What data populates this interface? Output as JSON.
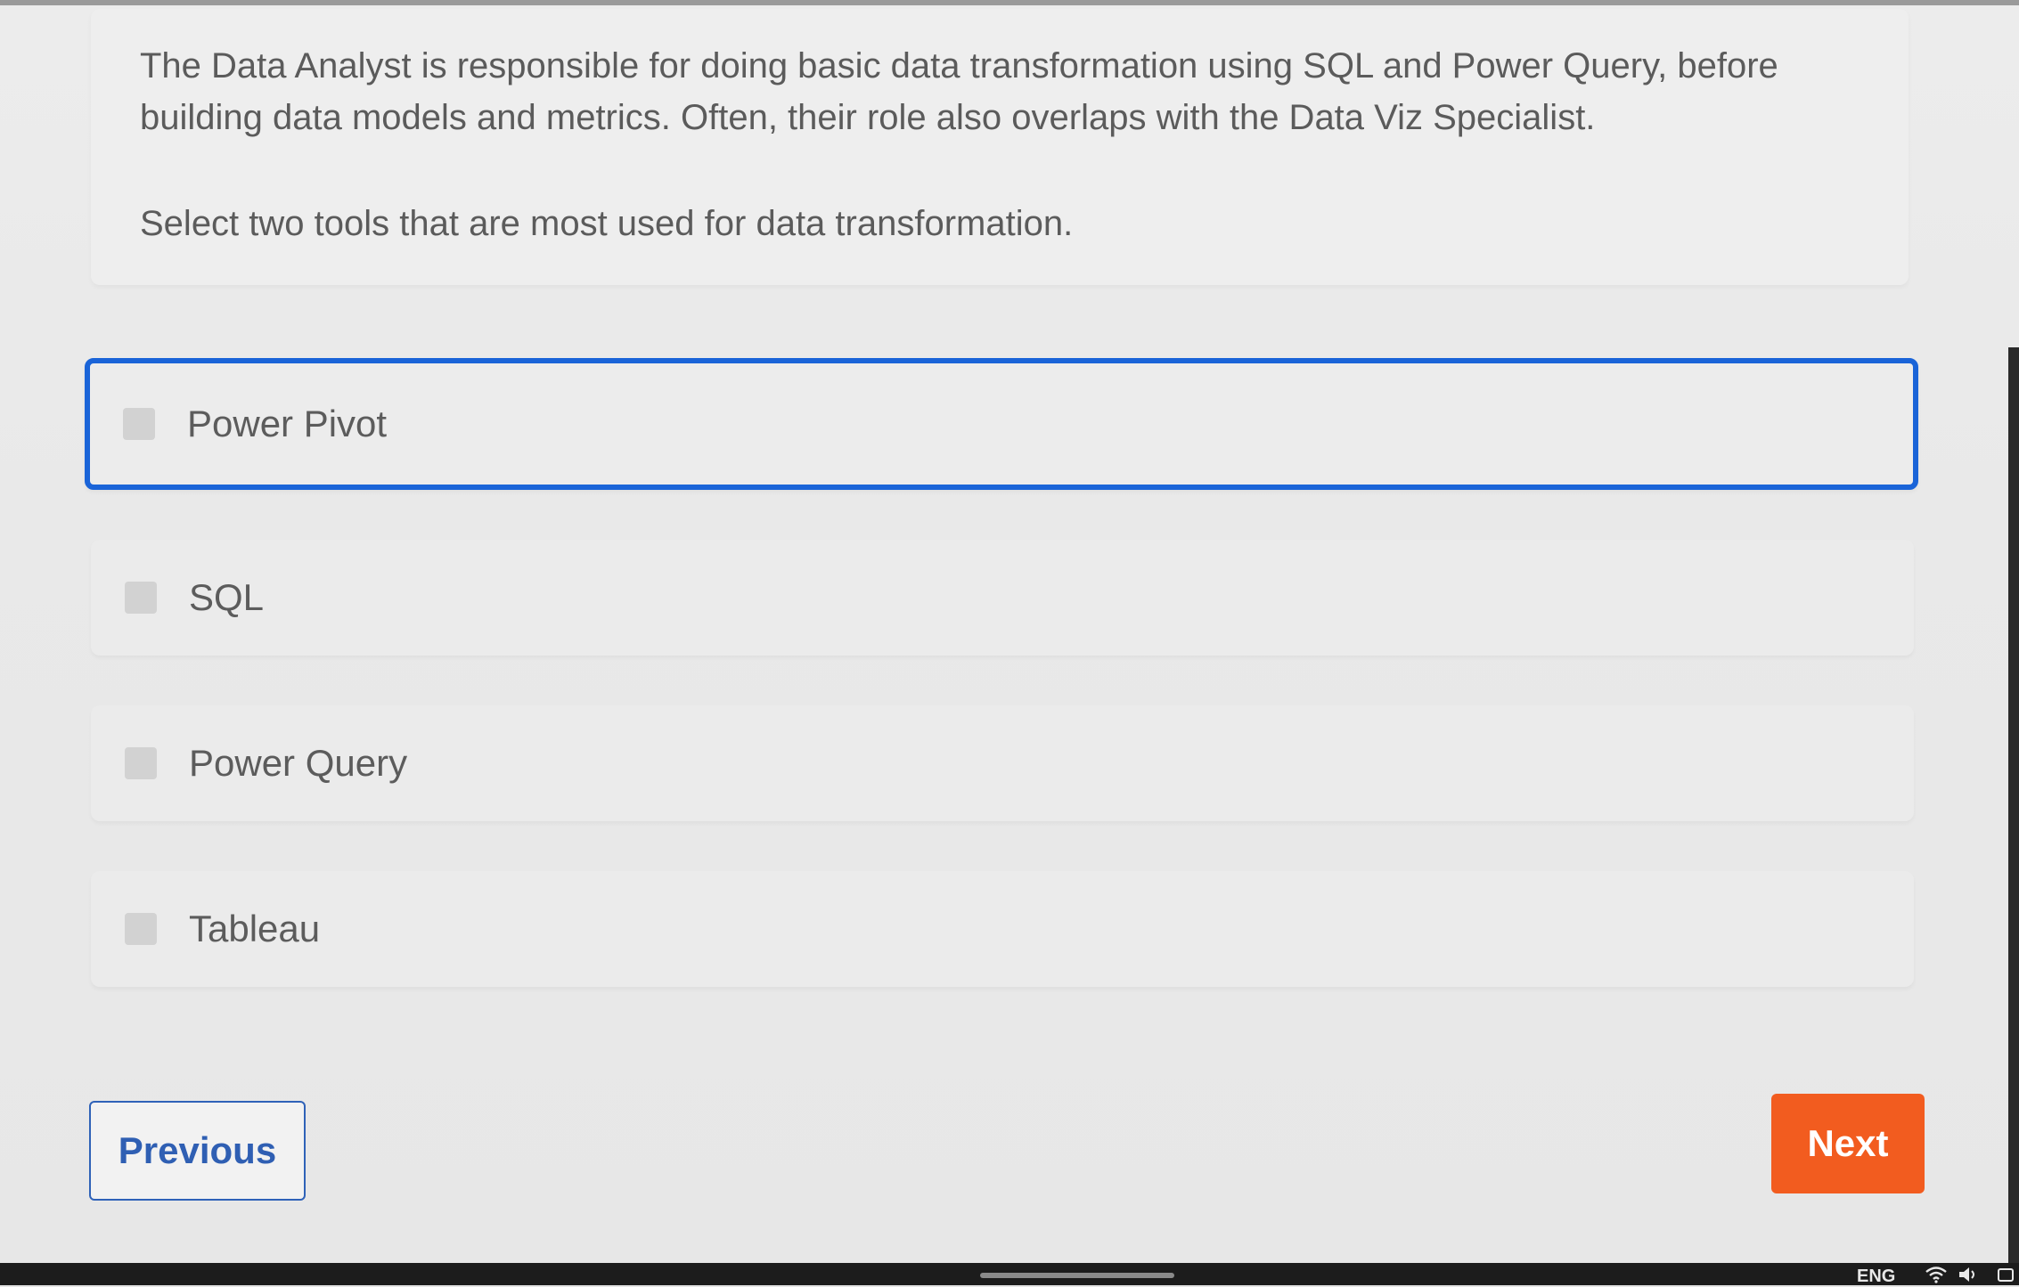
{
  "question": {
    "description": "The Data Analyst is responsible for doing basic data transformation using SQL and Power Query, before building data models and metrics. Often, their role also overlaps with the Data Viz Specialist.",
    "prompt": "Select two tools that are most used for data transformation."
  },
  "options": [
    {
      "label": "Power Pivot",
      "checked": false,
      "focused": true
    },
    {
      "label": "SQL",
      "checked": false,
      "focused": false
    },
    {
      "label": "Power Query",
      "checked": false,
      "focused": false
    },
    {
      "label": "Tableau",
      "checked": false,
      "focused": false
    }
  ],
  "navigation": {
    "previous_label": "Previous",
    "next_label": "Next"
  },
  "taskbar": {
    "language": "ENG",
    "icons": [
      "wifi-icon",
      "volume-icon",
      "battery-icon"
    ]
  },
  "colors": {
    "focus_border": "#1a64d8",
    "next_button": "#f25c1f",
    "previous_text": "#2f5fb3"
  }
}
